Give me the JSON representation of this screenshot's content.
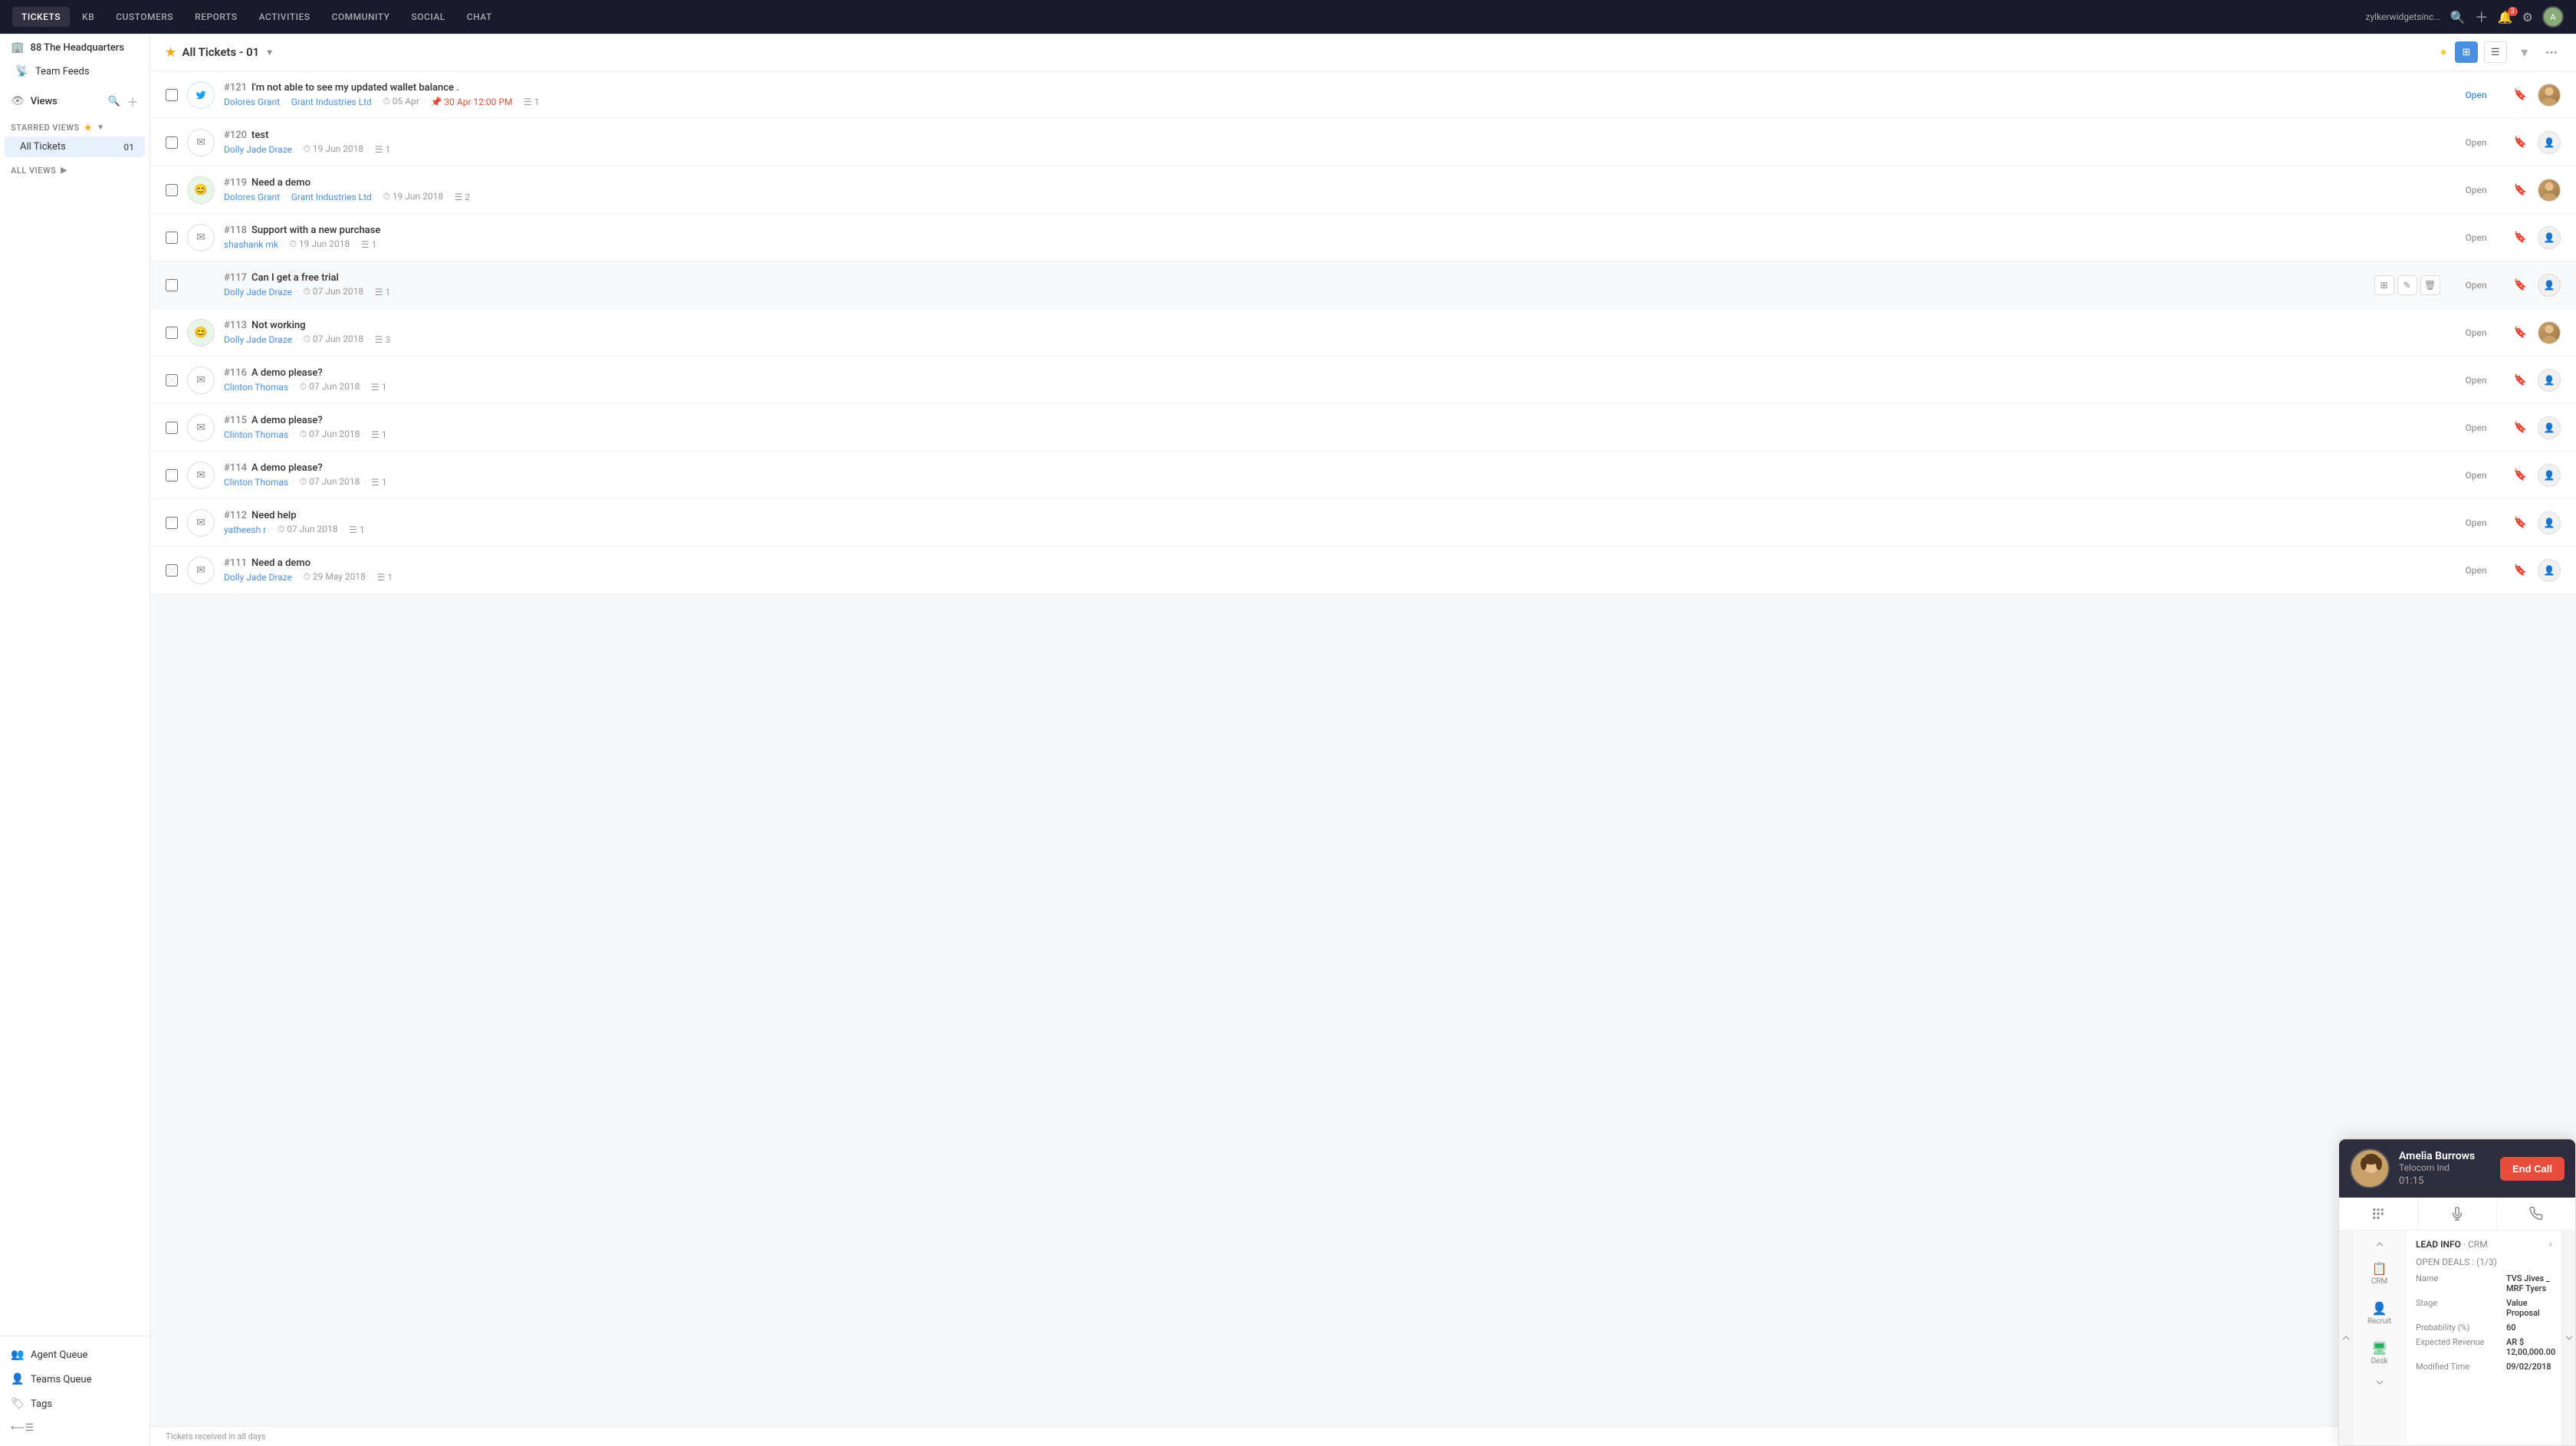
{
  "topNav": {
    "items": [
      {
        "label": "TICKETS",
        "active": true
      },
      {
        "label": "KB",
        "active": false
      },
      {
        "label": "CUSTOMERS",
        "active": false
      },
      {
        "label": "REPORTS",
        "active": false
      },
      {
        "label": "ACTIVITIES",
        "active": false
      },
      {
        "label": "COMMUNITY",
        "active": false
      },
      {
        "label": "SOCIAL",
        "active": false
      },
      {
        "label": "CHAT",
        "active": false
      }
    ],
    "domain": "zylkerwidgetsinc...",
    "notificationCount": "3"
  },
  "sidebar": {
    "headquarters": "88 The Headquarters",
    "teamFeeds": "Team Feeds",
    "views": "Views",
    "starredViews": "STARRED VIEWS",
    "allViews": "ALL VIEWS",
    "allTickets": "All Tickets",
    "allTicketsCount": "01",
    "bottomItems": [
      {
        "icon": "👥",
        "label": "Agent Queue"
      },
      {
        "icon": "👤",
        "label": "Teams Queue"
      },
      {
        "icon": "🏷",
        "label": "Tags"
      }
    ]
  },
  "toolbar": {
    "title": "All Tickets - 01",
    "star": "★",
    "viewBtn1": "⊞",
    "viewBtn2": "☰"
  },
  "tickets": [
    {
      "id": "121",
      "subject": "I'm not able to see my updated wallet balance .",
      "agent": "Dolores Grant",
      "company": "Grant Industries Ltd",
      "time1": "05 Apr",
      "time2": "30 Apr 12:00 PM",
      "replies": "1",
      "status": "Open",
      "statusColor": "blue",
      "channel": "twitter",
      "hasAvatar": true,
      "avatarColor": "#c0a080"
    },
    {
      "id": "120",
      "subject": "test",
      "agent": "Dolly Jade Draze",
      "company": "",
      "time1": "19 Jun 2018",
      "time2": "",
      "replies": "1",
      "status": "Open",
      "statusColor": "gray",
      "channel": "email",
      "hasAvatar": false,
      "avatarColor": ""
    },
    {
      "id": "119",
      "subject": "Need a demo",
      "agent": "Dolores Grant",
      "company": "Grant Industries Ltd",
      "time1": "19 Jun 2018",
      "time2": "",
      "replies": "2",
      "status": "Open",
      "statusColor": "gray",
      "channel": "emoji",
      "hasAvatar": true,
      "avatarColor": "#c0a080"
    },
    {
      "id": "118",
      "subject": "Support with a new purchase",
      "agent": "shashank mk",
      "company": "",
      "time1": "19 Jun 2018",
      "time2": "",
      "replies": "1",
      "status": "Open",
      "statusColor": "gray",
      "channel": "email",
      "hasAvatar": false,
      "avatarColor": ""
    },
    {
      "id": "117",
      "subject": "Can I get a free trial",
      "agent": "Dolly Jade Draze",
      "company": "",
      "time1": "07 Jun 2018",
      "time2": "",
      "replies": "1",
      "status": "Open",
      "statusColor": "gray",
      "channel": "none",
      "hasAvatar": false,
      "avatarColor": "",
      "showHoverActions": true
    },
    {
      "id": "113",
      "subject": "Not working",
      "agent": "Dolly Jade Draze",
      "company": "",
      "time1": "07 Jun 2018",
      "time2": "",
      "replies": "3",
      "status": "Open",
      "statusColor": "gray",
      "channel": "emoji",
      "hasAvatar": true,
      "avatarColor": "#c0a080"
    },
    {
      "id": "116",
      "subject": "A demo please?",
      "agent": "Clinton Thomas",
      "company": "",
      "time1": "07 Jun 2018",
      "time2": "",
      "replies": "1",
      "status": "Open",
      "statusColor": "gray",
      "channel": "email",
      "hasAvatar": false,
      "avatarColor": ""
    },
    {
      "id": "115",
      "subject": "A demo please?",
      "agent": "Clinton Thomas",
      "company": "",
      "time1": "07 Jun 2018",
      "time2": "",
      "replies": "1",
      "status": "Open",
      "statusColor": "gray",
      "channel": "email",
      "hasAvatar": false,
      "avatarColor": ""
    },
    {
      "id": "114",
      "subject": "A demo please?",
      "agent": "Clinton Thomas",
      "company": "",
      "time1": "07 Jun 2018",
      "time2": "",
      "replies": "1",
      "status": "Open",
      "statusColor": "gray",
      "channel": "email",
      "hasAvatar": false,
      "avatarColor": ""
    },
    {
      "id": "112",
      "subject": "Need help",
      "agent": "yatheesh r",
      "company": "",
      "time1": "07 Jun 2018",
      "time2": "",
      "replies": "1",
      "status": "Open",
      "statusColor": "gray",
      "channel": "email",
      "hasAvatar": false,
      "avatarColor": ""
    },
    {
      "id": "111",
      "subject": "Need a demo",
      "agent": "Dolly Jade Draze",
      "company": "",
      "time1": "29 May 2018",
      "time2": "",
      "replies": "1",
      "status": "Open",
      "statusColor": "gray",
      "channel": "email",
      "hasAvatar": false,
      "avatarColor": ""
    }
  ],
  "bottomBar": {
    "text": "Tickets received in all days"
  },
  "callWidget": {
    "callerName": "Amelia Burrows",
    "callerCompany": "Telocom Ind",
    "callDuration": "01:15",
    "endCallLabel": "End Call",
    "leadInfoLabel": "LEAD INFO",
    "crmLabel": "CRM",
    "openDeals": "OPEN DEALS : (1/3)",
    "fields": [
      {
        "key": "Name",
        "val": "TVS Jives _ MRF Tyers"
      },
      {
        "key": "Stage",
        "val": "Value Proposal"
      },
      {
        "key": "Probability (%)",
        "val": "60"
      },
      {
        "key": "Expected Revenue",
        "val": "AR $ 12,00,000.00"
      },
      {
        "key": "Modified Time",
        "val": "09/02/2018"
      }
    ],
    "sideTabs": [
      {
        "icon": "📋",
        "label": "CRM"
      },
      {
        "icon": "👤",
        "label": "Recruit"
      },
      {
        "icon": "🖥",
        "label": "Desk"
      }
    ]
  }
}
